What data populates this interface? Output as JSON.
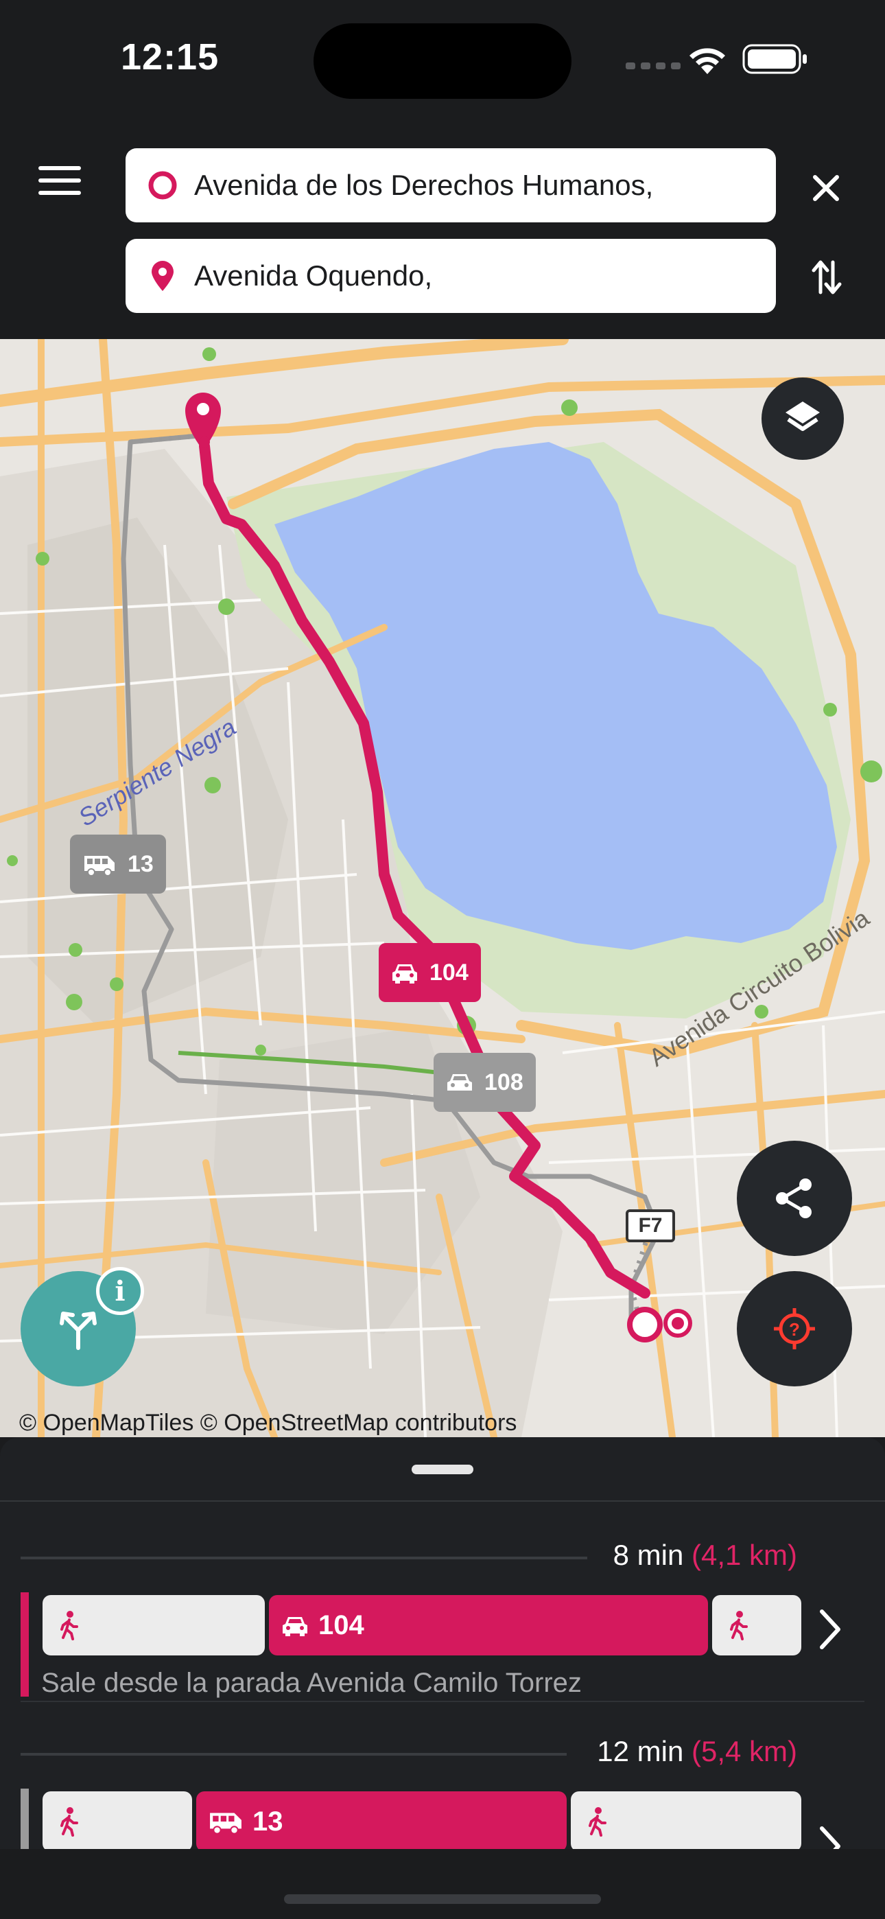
{
  "status_bar": {
    "time": "12:15"
  },
  "search": {
    "origin": "Avenida de los Derechos Humanos,",
    "destination": "Avenida Oquendo,"
  },
  "map": {
    "street_label": "Serpiente Negra",
    "road_label": "Avenida Circuito Bolivia",
    "shield": "F7",
    "badges": {
      "primary": "104",
      "secondary": "108",
      "bus": "13"
    },
    "attribution": "© OpenMapTiles © OpenStreetMap contributors",
    "info_glyph": "i",
    "colors": {
      "route": "#d5195d",
      "water": "#a4bef5",
      "park": "#d8e6c8",
      "road": "#f6c47a"
    }
  },
  "routes": [
    {
      "duration": "8 min",
      "distance": "(4,1 km)",
      "segments": [
        {
          "type": "walk",
          "icon": "walk-icon",
          "label": ""
        },
        {
          "type": "transit",
          "icon": "taxi-icon",
          "label": "104"
        },
        {
          "type": "walk",
          "icon": "walk-icon",
          "label": ""
        }
      ],
      "note": "Sale desde la parada Avenida Camilo Torrez"
    },
    {
      "duration": "12 min",
      "distance": "(5,4 km)",
      "segments": [
        {
          "type": "walk",
          "icon": "walk-icon",
          "label": ""
        },
        {
          "type": "transit",
          "icon": "bus-icon",
          "label": "13"
        },
        {
          "type": "walk",
          "icon": "walk-icon",
          "label": ""
        }
      ]
    }
  ]
}
